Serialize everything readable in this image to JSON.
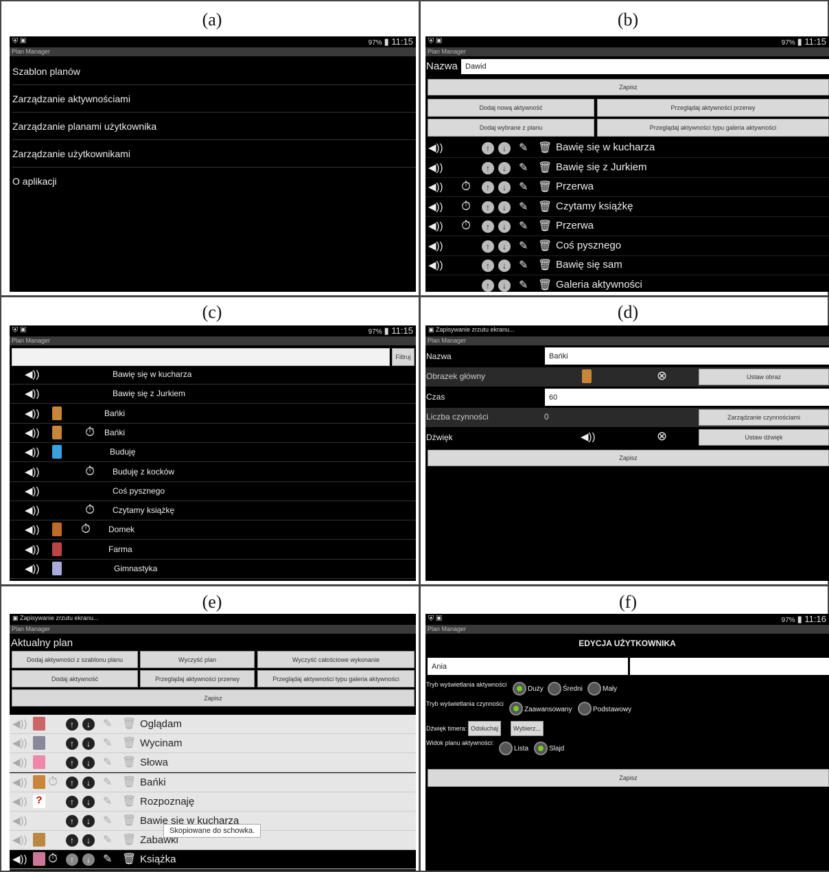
{
  "labels": {
    "a": "(a)",
    "b": "(b)",
    "c": "(c)",
    "d": "(d)",
    "e": "(e)",
    "f": "(f)"
  },
  "status": {
    "battery": "97%",
    "time_a": "11:15",
    "time_b": "11:15",
    "time_c": "11:15",
    "time_f": "11:16",
    "saving": "Zapisywanie zrzutu ekranu..."
  },
  "app_title": "Plan Manager",
  "a": {
    "menu": [
      "Szablon planów",
      "Zarządzanie aktywnościami",
      "Zarządzanie planami użytkownika",
      "Zarządzanie użytkownikami",
      "O aplikacji"
    ]
  },
  "b": {
    "name_label": "Nazwa",
    "name_value": "Dawid",
    "save": "Zapisz",
    "btn_add_new": "Dodaj nową aktywność",
    "btn_browse_break": "Przeglądaj aktywności przerwy",
    "btn_add_selected": "Dodaj wybrane z planu",
    "btn_browse_gallery": "Przeglądaj aktywności typu galeria aktywności",
    "rows": [
      "Bawię się w kucharza",
      "Bawię się z Jurkiem",
      "Przerwa",
      "Czytamy książkę",
      "Przerwa",
      "Coś pysznego",
      "Bawię się sam",
      "Galeria aktywności"
    ]
  },
  "c": {
    "filter": "Filtruj",
    "rows": [
      "Bawię się w kucharza",
      "Bawię się z Jurkiem",
      "Bańki",
      "Bańki",
      "Buduję",
      "Buduję z kocków",
      "Coś pysznego",
      "Czytamy książkę",
      "Domek",
      "Farma",
      "Gimnastyka"
    ]
  },
  "d": {
    "name_label": "Nazwa",
    "name_value": "Bańki",
    "image_label": "Obrazek główny",
    "set_image": "Ustaw obraz",
    "time_label": "Czas",
    "time_value": "60",
    "count_label": "Liczba czynności",
    "count_value": "0",
    "manage": "Zarządzanie czynnościami",
    "sound_label": "Dźwięk",
    "set_sound": "Ustaw dźwięk",
    "save": "Zapisz"
  },
  "e": {
    "title": "Aktualny plan",
    "btn1": "Dodaj aktywności z szablonu planu",
    "btn2": "Wyczyść plan",
    "btn3": "Wyczyść całościowe wykonanie",
    "btn4": "Dodaj aktywność",
    "btn5": "Przeglądaj aktywności przerwy",
    "btn6": "Przeglądaj aktywności typu galeria aktywności",
    "save": "Zapisz",
    "rows": [
      "Oglądam",
      "Wycinam",
      "Słowa",
      "Bańki",
      "Rozpoznaję",
      "Bawię się w kucharza",
      "Zabawki",
      "Książka"
    ],
    "toast": "Skopiowane do schowka."
  },
  "f": {
    "title": "EDYCJA UŻYTKOWNIKA",
    "name_value": "Ania",
    "mode_label": "Tryb wyświetlania aktywności",
    "opt_big": "Duży",
    "opt_mid": "Średni",
    "opt_small": "Mały",
    "act_mode_label": "Tryb wyświetlania czynności",
    "opt_adv": "Zaawansowany",
    "opt_basic": "Podstawowy",
    "timer_label": "Dźwięk timera:",
    "listen": "Odsłuchaj",
    "choose": "Wybierz...",
    "view_label": "Widok planu aktywności:",
    "opt_list": "Lista",
    "opt_slide": "Slajd",
    "save": "Zapisz"
  }
}
